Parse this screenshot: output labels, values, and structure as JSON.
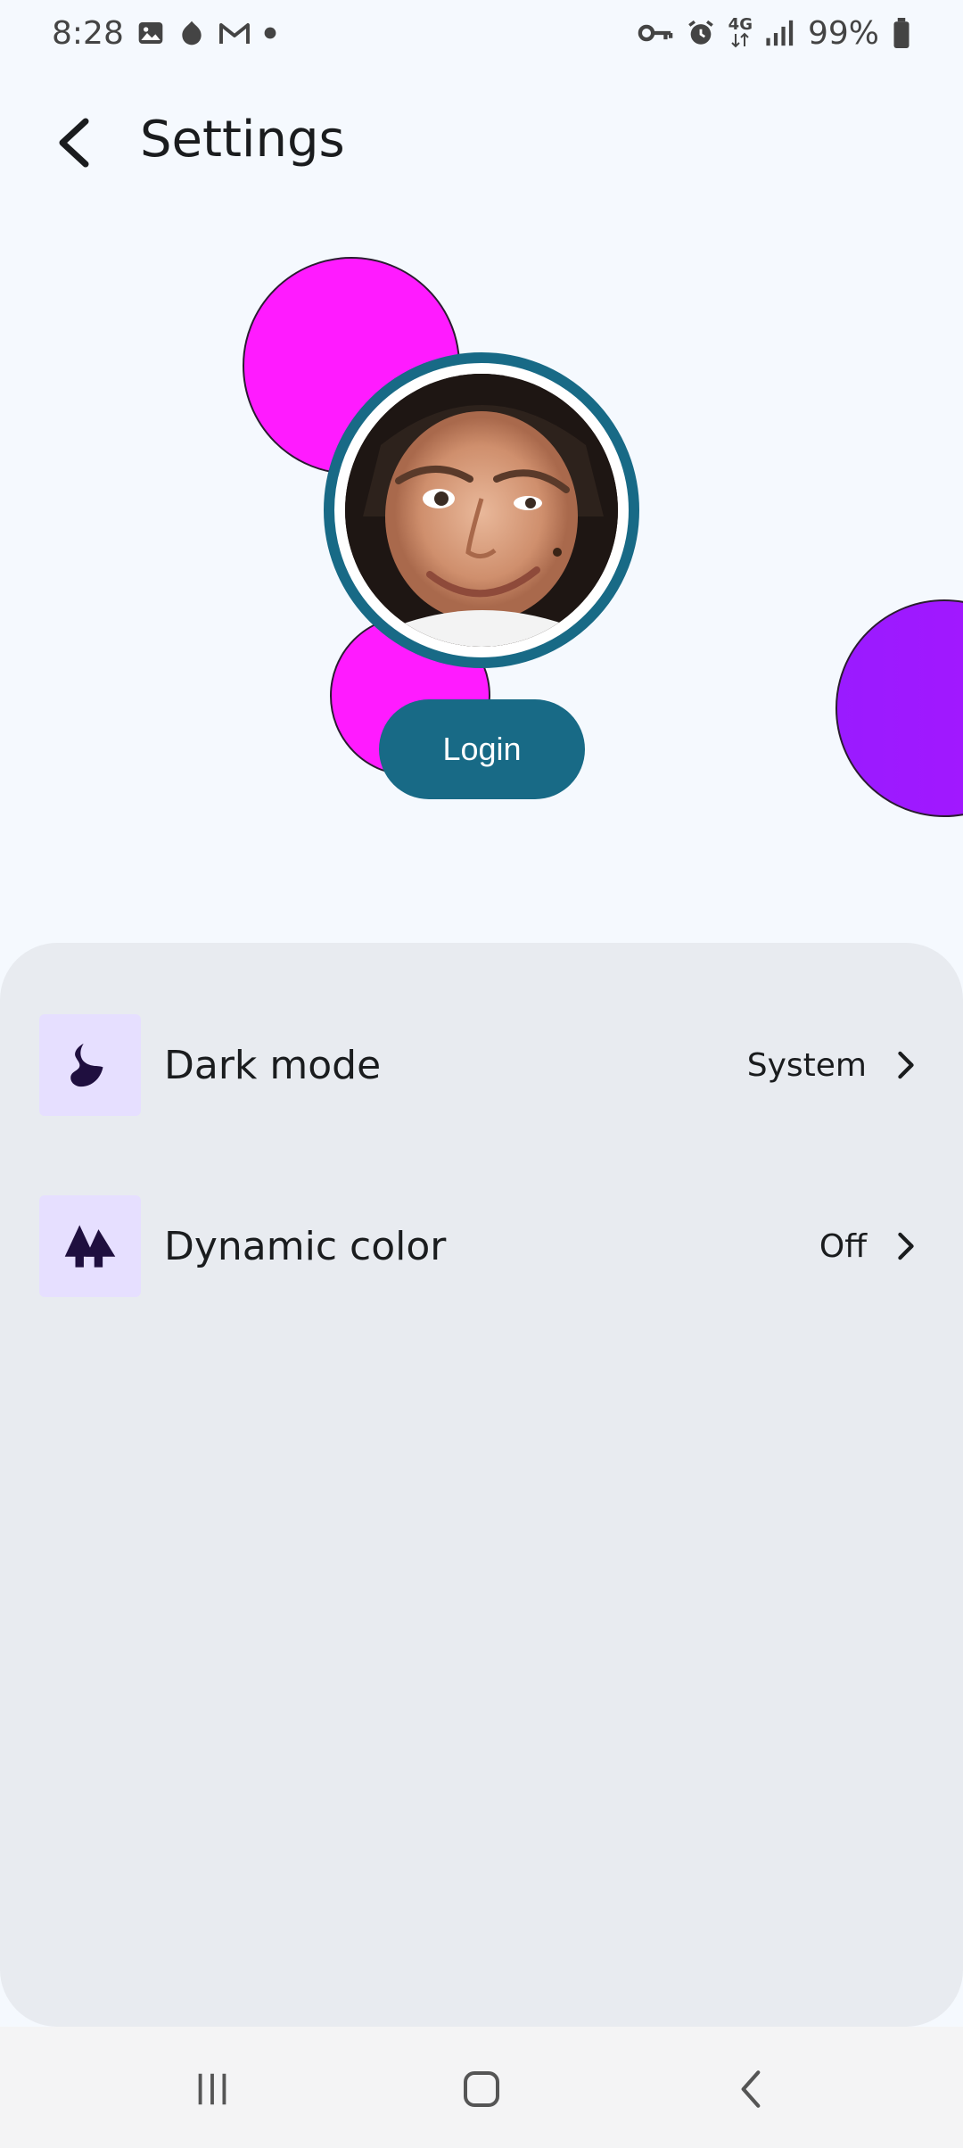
{
  "status_bar": {
    "time": "8:28",
    "battery": "99%",
    "network": "4G",
    "left_icons": [
      "gallery-icon",
      "app-icon",
      "gmail-icon",
      "dot-icon"
    ],
    "right_icons": [
      "vpn-key-icon",
      "alarm-icon",
      "network-4g-icon",
      "signal-icon",
      "battery-icon"
    ]
  },
  "app_bar": {
    "title": "Settings",
    "back_icon": "arrow-back-icon"
  },
  "profile": {
    "login_label": "Login",
    "colors": {
      "bubble_pink": "#ff1bff",
      "bubble_purple": "#9a1bff",
      "accent": "#186a86"
    }
  },
  "settings": {
    "items": [
      {
        "icon": "dark-mode-icon",
        "label": "Dark mode",
        "value": "System"
      },
      {
        "icon": "dynamic-color-icon",
        "label": "Dynamic color",
        "value": "Off"
      }
    ],
    "icon_bg": "#e6dfff",
    "card_bg": "#e8ebf0"
  },
  "nav_bar": {
    "buttons": [
      "recents-icon",
      "home-icon",
      "back-icon"
    ]
  }
}
